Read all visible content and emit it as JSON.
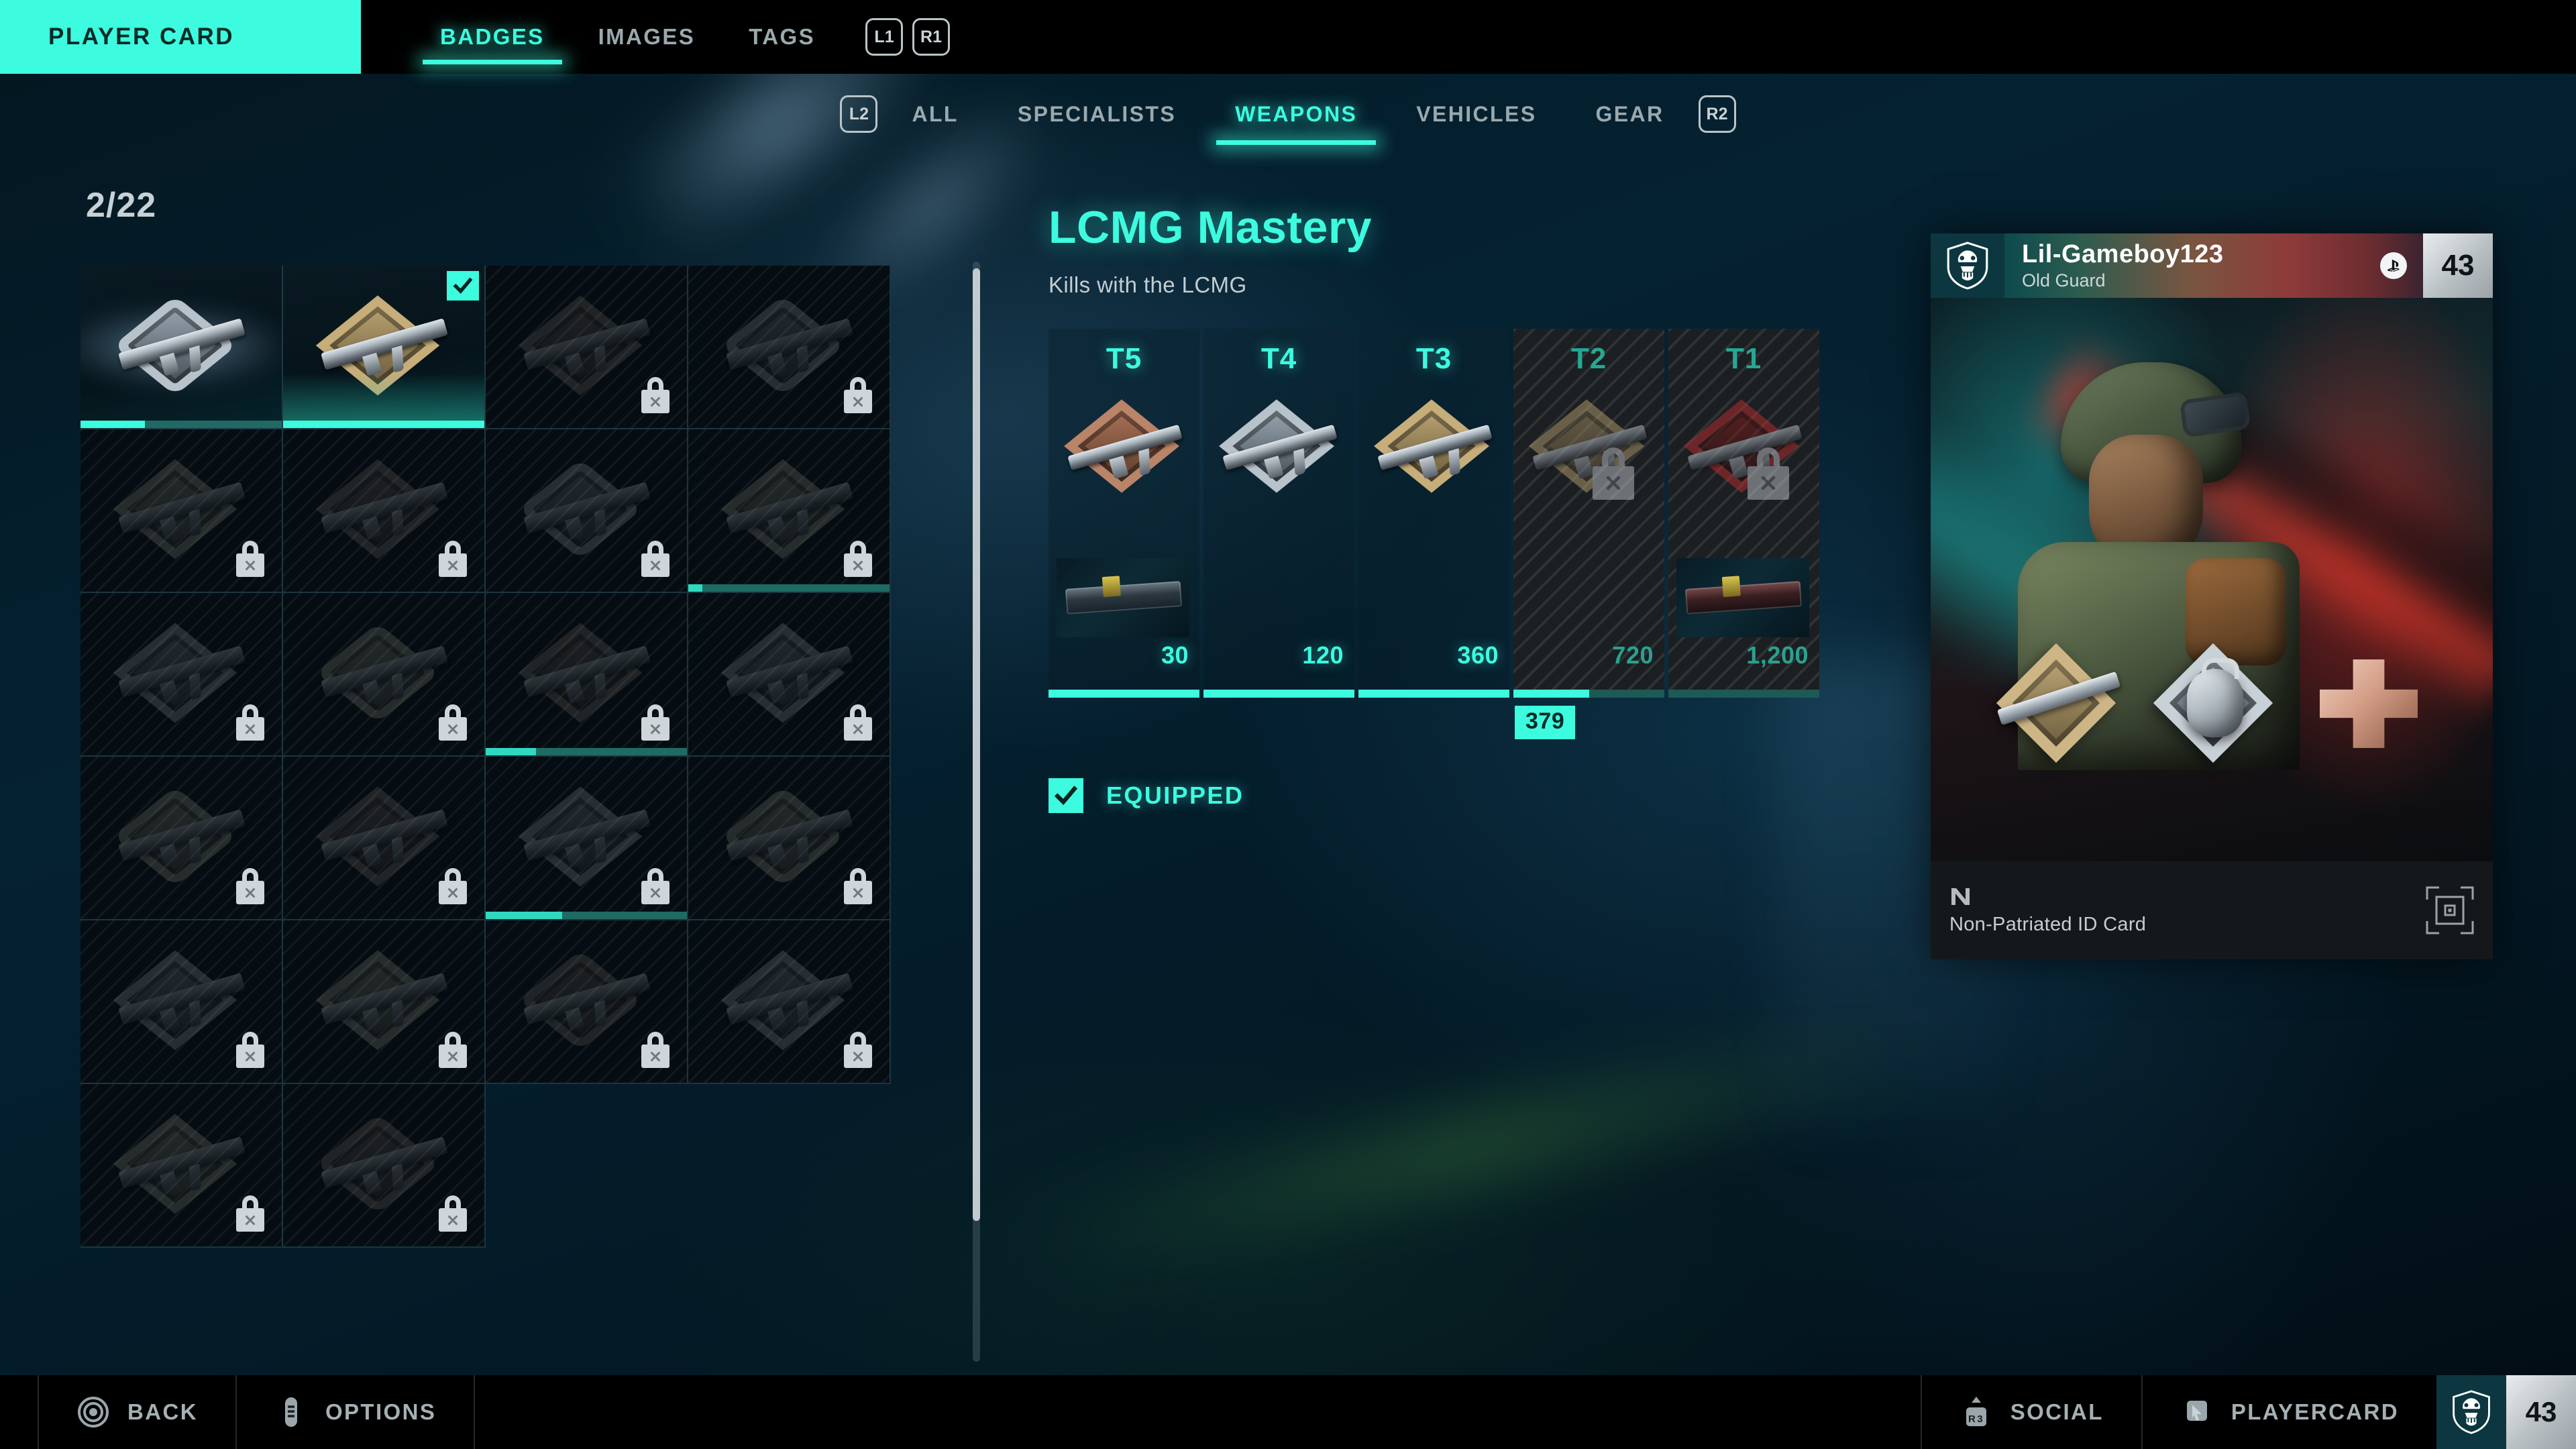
{
  "topnav": {
    "player_card_tab": "PLAYER CARD",
    "items": [
      {
        "label": "BADGES",
        "active": true
      },
      {
        "label": "IMAGES",
        "active": false
      },
      {
        "label": "TAGS",
        "active": false
      }
    ],
    "bumper_left": "L1",
    "bumper_right": "R1"
  },
  "subnav": {
    "bumper_left": "L2",
    "bumper_right": "R2",
    "items": [
      {
        "label": "ALL",
        "active": false
      },
      {
        "label": "SPECIALISTS",
        "active": false
      },
      {
        "label": "WEAPONS",
        "active": true
      },
      {
        "label": "VEHICLES",
        "active": false
      },
      {
        "label": "GEAR",
        "active": false
      }
    ]
  },
  "grid": {
    "count": "2/22",
    "cells": [
      {
        "state": "unlocked",
        "selected": true,
        "equipped": false,
        "progress": 32,
        "art": "hex-rifle-silver"
      },
      {
        "state": "unlocked",
        "selected": false,
        "equipped": true,
        "progress": 100,
        "art": "diamond-rifle-gold"
      },
      {
        "state": "locked",
        "progress": 0,
        "art": "triangle-rifle"
      },
      {
        "state": "locked",
        "progress": 0,
        "art": "wedge-rifle"
      },
      {
        "state": "locked",
        "progress": 0,
        "art": "shield-rifle"
      },
      {
        "state": "locked",
        "progress": 0,
        "art": "hex-carbine"
      },
      {
        "state": "locked",
        "progress": 0,
        "art": "chevron-rifle"
      },
      {
        "state": "locked",
        "progress": 7,
        "art": "frame-rifle"
      },
      {
        "state": "locked",
        "progress": 0,
        "art": "ring-smg"
      },
      {
        "state": "locked",
        "progress": 0,
        "art": "octagon-rifle"
      },
      {
        "state": "locked",
        "progress": 25,
        "art": "square-rifle"
      },
      {
        "state": "locked",
        "progress": 0,
        "art": "frame-smg"
      },
      {
        "state": "locked",
        "progress": 0,
        "art": "cross-rifle"
      },
      {
        "state": "locked",
        "progress": 0,
        "art": "hex-smg"
      },
      {
        "state": "locked",
        "progress": 38,
        "art": "plate-pistol"
      },
      {
        "state": "locked",
        "progress": 0,
        "art": "bar-pistol"
      },
      {
        "state": "locked",
        "progress": 0,
        "art": "diamond-rifle"
      },
      {
        "state": "locked",
        "progress": 0,
        "art": "spike-rifle"
      },
      {
        "state": "locked",
        "progress": 0,
        "art": "swirl-knife"
      },
      {
        "state": "locked",
        "progress": 0,
        "art": "wing-rifle"
      },
      {
        "state": "locked",
        "progress": 0,
        "art": "hatch-rifle"
      },
      {
        "state": "locked",
        "progress": 0,
        "art": "hatch-smg"
      }
    ]
  },
  "detail": {
    "title": "LCMG Mastery",
    "description": "Kills with the LCMG",
    "progress_callout": "379",
    "equipped_label": "EQUIPPED",
    "equipped_checked": true,
    "tiers": [
      {
        "label": "T5",
        "value": "30",
        "locked": false,
        "fill": 100,
        "medal": "bronze",
        "skin": true,
        "skin_variant": "teal"
      },
      {
        "label": "T4",
        "value": "120",
        "locked": false,
        "fill": 100,
        "medal": "silver",
        "skin": false
      },
      {
        "label": "T3",
        "value": "360",
        "locked": false,
        "fill": 100,
        "medal": "gold",
        "skin": false
      },
      {
        "label": "T2",
        "value": "720",
        "locked": true,
        "fill": 50,
        "medal": "dark-gold",
        "skin": false
      },
      {
        "label": "T1",
        "value": "1,200",
        "locked": true,
        "fill": 0,
        "medal": "red",
        "skin": true,
        "skin_variant": "red"
      }
    ]
  },
  "player_card": {
    "name": "Lil-Gameboy123",
    "clan": "Old Guard",
    "level": "43",
    "platform_icon": "playstation-icon",
    "emblem_icon": "bear-shield-icon",
    "card_name": "Non-Patriated ID Card",
    "brand_icon": "n-logo-icon",
    "qr_icon": "qr-code-icon",
    "medals": [
      "weapon-medal-gold",
      "grenade-medal-silver",
      "medic-cross-medal-bronze"
    ]
  },
  "bottom_bar": {
    "items": [
      {
        "label": "BACK",
        "icon": "circle-button-icon"
      },
      {
        "label": "OPTIONS",
        "icon": "options-button-icon"
      }
    ],
    "right_items": [
      {
        "label": "SOCIAL",
        "icon": "r3-stick-icon",
        "button": "R3"
      },
      {
        "label": "PLAYERCARD",
        "icon": "cursor-card-icon"
      }
    ],
    "level": "43",
    "emblem_icon": "bear-shield-icon"
  },
  "colors": {
    "accent": "#3dfbdf",
    "accent_dim": "#1f6b63",
    "locked_panel": "#1c1f22",
    "panel_bg": "#050d12"
  }
}
